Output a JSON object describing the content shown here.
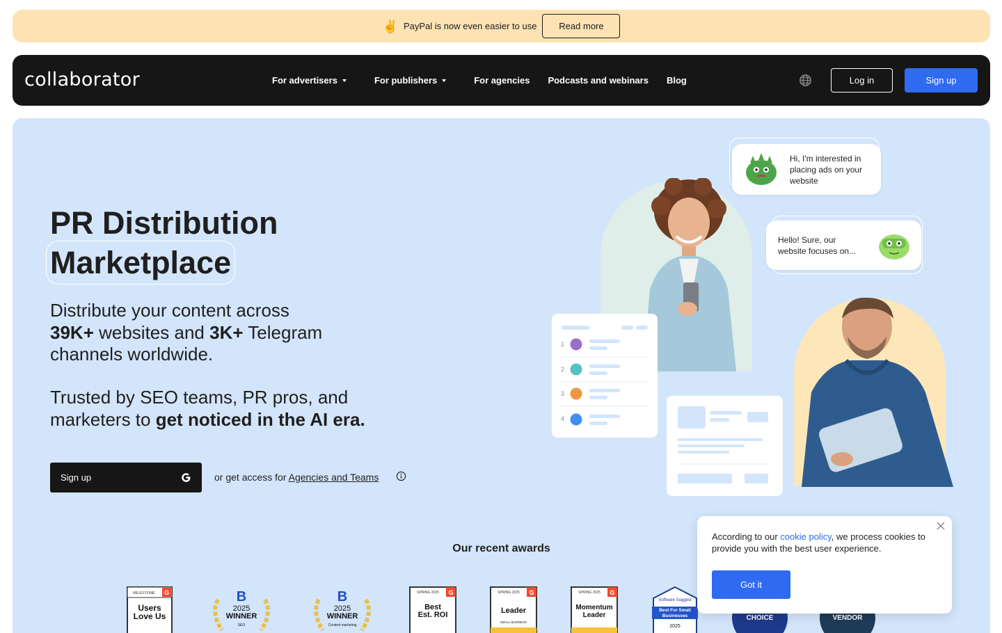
{
  "promo": {
    "emoji": "✌️",
    "text": "PayPal is now even easier to use",
    "button": "Read more"
  },
  "nav": {
    "logo": "collaborator",
    "links": [
      {
        "label": "For advertisers",
        "dropdown": true
      },
      {
        "label": "For publishers",
        "dropdown": true
      },
      {
        "label": "For agencies",
        "dropdown": false
      },
      {
        "label": "Podcasts and webinars",
        "dropdown": false
      },
      {
        "label": "Blog",
        "dropdown": false
      }
    ],
    "globe_icon": "globe-icon",
    "login": "Log in",
    "signup": "Sign up"
  },
  "hero": {
    "title_line1": "PR Distribution",
    "title_line2": "Marketplace",
    "sub_a": "Distribute your content across",
    "sub_b_bold1": "39K+",
    "sub_b_mid": " websites and ",
    "sub_b_bold2": "3K+",
    "sub_b_end": " Telegram",
    "sub_c": "channels worldwide.",
    "sub2_a": "Trusted by SEO teams, PR pros, and",
    "sub2_b": "marketers to ",
    "sub2_bold": "get noticed in the AI era.",
    "signup": "Sign up",
    "access_prefix": "or get access for ",
    "access_link": "Agencies and Teams",
    "awards_title": "Our recent awards"
  },
  "chat": {
    "bubble1": "Hi, I'm interested in placing ads on your website",
    "bubble2": "Hello! Sure, our website focuses on..."
  },
  "list_card": {
    "rows": [
      {
        "num": "1",
        "color": "#9a6ecb"
      },
      {
        "num": "2",
        "color": "#56c2c4"
      },
      {
        "num": "3",
        "color": "#f0963e"
      },
      {
        "num": "4",
        "color": "#3f8ef2"
      }
    ]
  },
  "awards": [
    {
      "top": "MILESTONE",
      "line1": "Users",
      "line2": "Love Us"
    },
    {
      "year": "2025",
      "line1": "WINNER",
      "line2": "SEO"
    },
    {
      "year": "2025",
      "line1": "WINNER",
      "line2": "Content marketing"
    },
    {
      "top": "SPRING 2025",
      "line1": "Best",
      "line2": "Est. ROI"
    },
    {
      "top": "SPRING 2025",
      "line1": "Leader",
      "line2": "SMALL BUSINESS"
    },
    {
      "top": "SPRING 2025",
      "line1": "Momentum",
      "line2": "Leader"
    },
    {
      "top": "Software Suggest",
      "line1": "Best For Small",
      "line2": "Businesses",
      "year": "2025"
    },
    {
      "line1": "CHOICE"
    },
    {
      "line1": "VENDOR"
    }
  ],
  "cookie": {
    "text_a": "According to our ",
    "link": "cookie policy",
    "text_b": ", we process cookies to provide you with the best user experience.",
    "button": "Got it"
  },
  "colors": {
    "accent": "#2e6bf0",
    "promo_bg": "#fde3b4",
    "nav_bg": "#161616",
    "hero_bg": "#d3e5fb"
  }
}
